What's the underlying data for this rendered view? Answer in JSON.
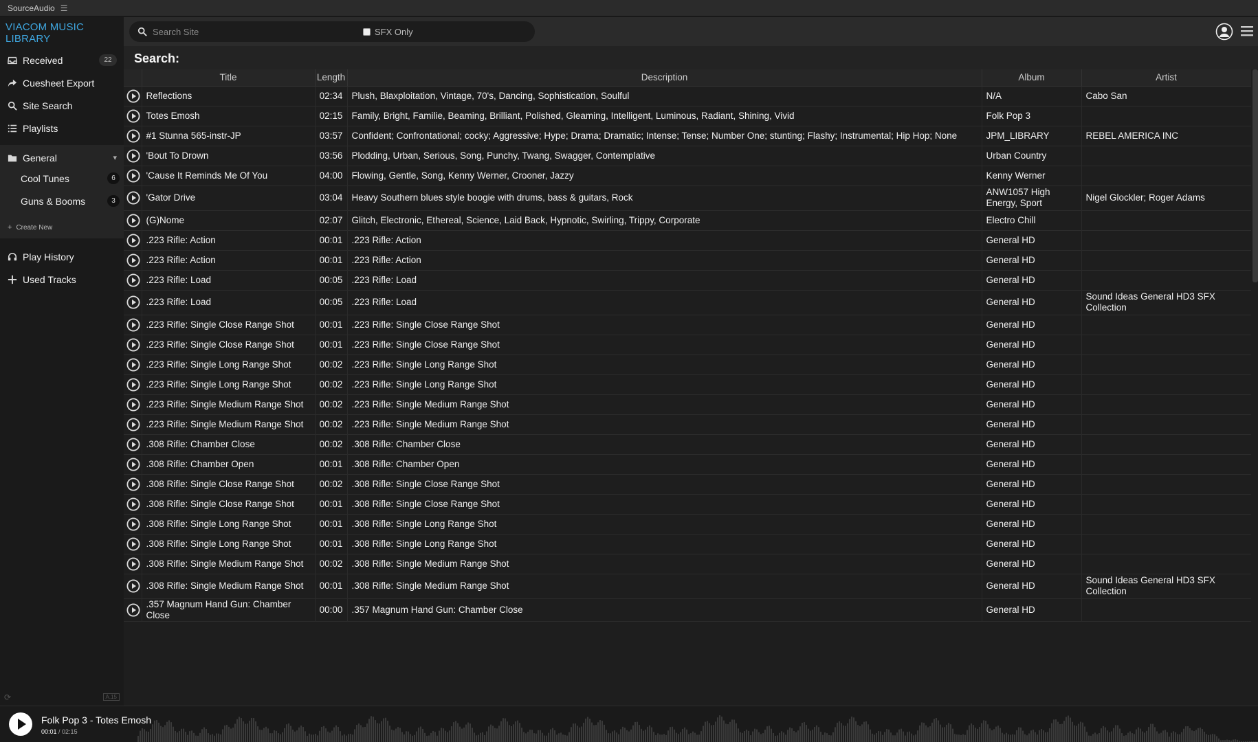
{
  "app_title": "SourceAudio",
  "sidebar": {
    "brand": "VIACOM MUSIC LIBRARY",
    "nav": [
      {
        "label": "Received",
        "icon": "inbox-icon",
        "count": "22"
      },
      {
        "label": "Cuesheet Export",
        "icon": "share-arrow-icon"
      },
      {
        "label": "Site Search",
        "icon": "search-icon"
      },
      {
        "label": "Playlists",
        "icon": "list-icon"
      }
    ],
    "folder": {
      "label": "General",
      "icon": "folder-icon"
    },
    "playlists": [
      {
        "label": "Cool Tunes",
        "count": "6"
      },
      {
        "label": "Guns & Booms",
        "count": "3"
      }
    ],
    "create_new": "Create New",
    "lower_nav": [
      {
        "label": "Play History",
        "icon": "headphones-icon"
      },
      {
        "label": "Used Tracks",
        "icon": "plus-icon"
      }
    ],
    "version": "A.15"
  },
  "search": {
    "placeholder": "Search Site",
    "sfx_label": "SFX Only"
  },
  "page_title": "Search:",
  "table": {
    "headers": {
      "title": "Title",
      "length": "Length",
      "description": "Description",
      "album": "Album",
      "artist": "Artist"
    },
    "rows": [
      {
        "title": "Reflections",
        "length": "02:34",
        "description": "Plush, Blaxploitation, Vintage, 70's, Dancing, Sophistication, Soulful",
        "album": "N/A",
        "artist": "Cabo San"
      },
      {
        "title": "Totes Emosh",
        "length": "02:15",
        "description": "Family, Bright, Familie, Beaming, Brilliant, Polished, Gleaming, Intelligent, Luminous, Radiant, Shining, Vivid",
        "album": "Folk Pop 3",
        "artist": ""
      },
      {
        "title": "#1 Stunna 565-instr-JP",
        "length": "03:57",
        "description": "Confident; Confrontational; cocky; Aggressive; Hype; Drama; Dramatic; Intense; Tense; Number One; stunting; Flashy; Instrumental; Hip Hop; None",
        "album": "JPM_LIBRARY",
        "artist": "REBEL AMERICA INC"
      },
      {
        "title": "'Bout To Drown",
        "length": "03:56",
        "description": "Plodding, Urban, Serious, Song, Punchy, Twang, Swagger, Contemplative",
        "album": "Urban Country",
        "artist": ""
      },
      {
        "title": "'Cause It Reminds Me Of You",
        "length": "04:00",
        "description": "Flowing, Gentle, Song, Kenny Werner, Crooner, Jazzy",
        "album": "Kenny Werner",
        "artist": ""
      },
      {
        "title": "'Gator Drive",
        "length": "03:04",
        "description": "Heavy Southern blues style boogie with drums, bass & guitars, Rock",
        "album": "ANW1057 High Energy, Sport",
        "artist": "Nigel Glockler; Roger Adams"
      },
      {
        "title": "(G)Nome",
        "length": "02:07",
        "description": "Glitch, Electronic, Ethereal, Science, Laid Back, Hypnotic, Swirling, Trippy, Corporate",
        "album": "Electro Chill",
        "artist": ""
      },
      {
        "title": ".223 Rifle: Action",
        "length": "00:01",
        "description": ".223 Rifle: Action",
        "album": "General HD",
        "artist": ""
      },
      {
        "title": ".223 Rifle: Action",
        "length": "00:01",
        "description": ".223 Rifle: Action",
        "album": "General HD",
        "artist": ""
      },
      {
        "title": ".223 Rifle: Load",
        "length": "00:05",
        "description": ".223 Rifle: Load",
        "album": "General HD",
        "artist": ""
      },
      {
        "title": ".223 Rifle: Load",
        "length": "00:05",
        "description": ".223 Rifle: Load",
        "album": "General HD",
        "artist": "Sound Ideas General HD3 SFX Collection"
      },
      {
        "title": ".223 Rifle: Single Close Range Shot",
        "length": "00:01",
        "description": ".223 Rifle: Single Close Range Shot",
        "album": "General HD",
        "artist": ""
      },
      {
        "title": ".223 Rifle: Single Close Range Shot",
        "length": "00:01",
        "description": ".223 Rifle: Single Close Range Shot",
        "album": "General HD",
        "artist": ""
      },
      {
        "title": ".223 Rifle: Single Long Range Shot",
        "length": "00:02",
        "description": ".223 Rifle: Single Long Range Shot",
        "album": "General HD",
        "artist": ""
      },
      {
        "title": ".223 Rifle: Single Long Range Shot",
        "length": "00:02",
        "description": ".223 Rifle: Single Long Range Shot",
        "album": "General HD",
        "artist": ""
      },
      {
        "title": ".223 Rifle: Single Medium Range Shot",
        "length": "00:02",
        "description": ".223 Rifle: Single Medium Range Shot",
        "album": "General HD",
        "artist": ""
      },
      {
        "title": ".223 Rifle: Single Medium Range Shot",
        "length": "00:02",
        "description": ".223 Rifle: Single Medium Range Shot",
        "album": "General HD",
        "artist": ""
      },
      {
        "title": ".308 Rifle: Chamber Close",
        "length": "00:02",
        "description": ".308 Rifle: Chamber Close",
        "album": "General HD",
        "artist": ""
      },
      {
        "title": ".308 Rifle: Chamber Open",
        "length": "00:01",
        "description": ".308 Rifle: Chamber Open",
        "album": "General HD",
        "artist": ""
      },
      {
        "title": ".308 Rifle: Single Close Range Shot",
        "length": "00:02",
        "description": ".308 Rifle: Single Close Range Shot",
        "album": "General HD",
        "artist": ""
      },
      {
        "title": ".308 Rifle: Single Close Range Shot",
        "length": "00:01",
        "description": ".308 Rifle: Single Close Range Shot",
        "album": "General HD",
        "artist": ""
      },
      {
        "title": ".308 Rifle: Single Long Range Shot",
        "length": "00:01",
        "description": ".308 Rifle: Single Long Range Shot",
        "album": "General HD",
        "artist": ""
      },
      {
        "title": ".308 Rifle: Single Long Range Shot",
        "length": "00:01",
        "description": ".308 Rifle: Single Long Range Shot",
        "album": "General HD",
        "artist": ""
      },
      {
        "title": ".308 Rifle: Single Medium Range Shot",
        "length": "00:02",
        "description": ".308 Rifle: Single Medium Range Shot",
        "album": "General HD",
        "artist": ""
      },
      {
        "title": ".308 Rifle: Single Medium Range Shot",
        "length": "00:01",
        "description": ".308 Rifle: Single Medium Range Shot",
        "album": "General HD",
        "artist": "Sound Ideas General HD3 SFX Collection"
      },
      {
        "title": ".357 Magnum Hand Gun: Chamber Close",
        "length": "00:00",
        "description": ".357 Magnum Hand Gun: Chamber Close",
        "album": "General HD",
        "artist": ""
      }
    ]
  },
  "player": {
    "now_playing": "Folk Pop 3 - Totes Emosh",
    "current_time": "00:01",
    "duration": "/ 02:15"
  },
  "colors": {
    "brand": "#3fa7e0",
    "background": "#1e1e1e"
  }
}
